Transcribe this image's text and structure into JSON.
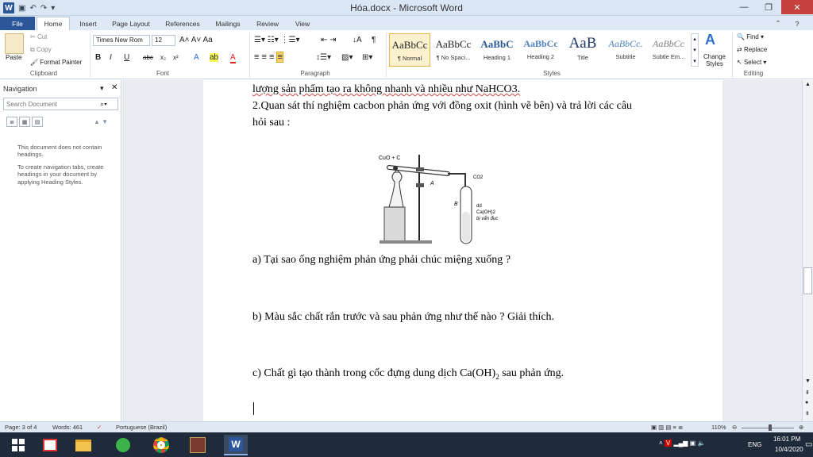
{
  "window": {
    "title": "Hóa.docx - Microsoft Word",
    "app_letter": "W"
  },
  "tabs": [
    "File",
    "Home",
    "Insert",
    "Page Layout",
    "References",
    "Mailings",
    "Review",
    "View"
  ],
  "ribbon": {
    "clipboard": {
      "paste": "Paste",
      "cut": "Cut",
      "copy": "Copy",
      "format_painter": "Format Painter",
      "label": "Clipboard"
    },
    "font": {
      "name": "Times New Rom",
      "size": "12",
      "label": "Font"
    },
    "paragraph": {
      "label": "Paragraph"
    },
    "styles": {
      "label": "Styles",
      "items": [
        {
          "sample": "AaBbCc",
          "name": "¶ Normal"
        },
        {
          "sample": "AaBbCc",
          "name": "¶ No Spaci..."
        },
        {
          "sample": "AaBbC",
          "name": "Heading 1"
        },
        {
          "sample": "AaBbCc",
          "name": "Heading 2"
        },
        {
          "sample": "AaB",
          "name": "Title"
        },
        {
          "sample": "AaBbCc.",
          "name": "Subtitle"
        },
        {
          "sample": "AaBbCc",
          "name": "Subtle Em..."
        }
      ],
      "change_styles": "Change Styles"
    },
    "editing": {
      "find": "Find",
      "replace": "Replace",
      "select": "Select",
      "label": "Editing"
    }
  },
  "nav": {
    "title": "Navigation",
    "search_placeholder": "Search Document",
    "message_1": "This document does not contain headings.",
    "message_2": "To create navigation tabs, create headings in your document by applying Heading Styles."
  },
  "document": {
    "line_top": "lượng sản phẩm tạo ra không nhanh và nhiều như NaHCO3.",
    "line_2a": "2.Quan sát thí nghiệm cacbon phản ứng với đồng oxit  (hình vẽ bên) và trả lời các câu",
    "line_2b": "hỏi sau :",
    "figure": {
      "label_top": "CuO + C",
      "label_a": "A",
      "label_b": "B",
      "label_co2": "CO2",
      "label_dd1": "dd",
      "label_dd2": "Ca(OH)2",
      "label_dd3": "bị vẩn đục"
    },
    "q_a": "a) Tại sao ống nghiệm phản ứng phải chúc miệng xuống ?",
    "q_b": "b) Màu sắc chất rắn trước và sau phản ứng như thế nào ? Giải thích.",
    "q_c_pre": "c) Chất gì tạo thành trong cốc đựng dung dịch Ca(OH)",
    "q_c_sub": "2",
    "q_c_post": " sau phản ứng."
  },
  "status": {
    "page": "Page: 3 of 4",
    "words": "Words: 461",
    "language": "Portuguese (Brazil)",
    "zoom": "110%"
  },
  "taskbar": {
    "lang": "ENG",
    "time": "16:01 PM",
    "date": "10/4/2020"
  }
}
